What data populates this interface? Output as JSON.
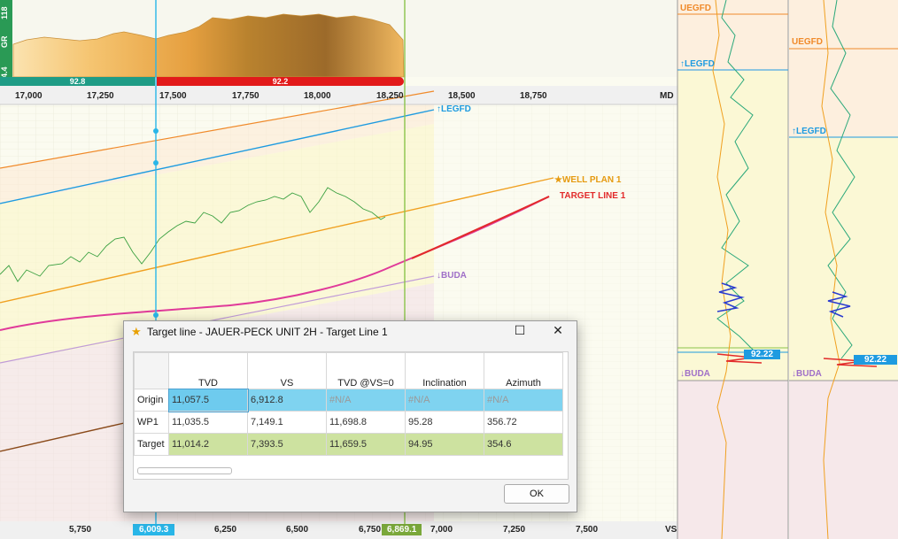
{
  "gamma_track": {
    "label": "GR",
    "scale_max": "118",
    "scale_min": "4.4",
    "bar_left_value": "92.8",
    "bar_right_value": "92.2",
    "colors": {
      "left_bar": "#1f9c86",
      "right_bar": "#e21a1a"
    }
  },
  "md_axis": {
    "ticks": [
      "17,000",
      "17,250",
      "17,500",
      "17,750",
      "18,000",
      "18,250",
      "18,500",
      "18,750"
    ],
    "unit": "MD"
  },
  "vs_axis": {
    "ticks": [
      "5,750",
      "6,250",
      "6,500",
      "6,750",
      "7,000",
      "7,250",
      "7,500"
    ],
    "unit": "VS",
    "cursor_a": "6,009.3",
    "cursor_b": "6,869.1",
    "colors": {
      "cursor_a": "#29b6e8",
      "cursor_b": "#7aa83a"
    }
  },
  "section_labels": {
    "legfd": "↑LEGFD",
    "well_plan": "★WELL PLAN 1",
    "target_line": "TARGET LINE 1",
    "buda": "↓BUDA"
  },
  "log_panel_1": {
    "uegfd": "UEGFD",
    "legfd": "↑LEGFD",
    "buda": "↓BUDA",
    "value": "92.22"
  },
  "log_panel_2": {
    "uegfd": "UEGFD",
    "legfd": "↑LEGFD",
    "buda": "↓BUDA",
    "value": "92.22"
  },
  "dialog": {
    "title": "Target line - JAUER-PECK UNIT 2H - Target Line 1",
    "columns": [
      "TVD",
      "VS",
      "TVD @VS=0",
      "Inclination",
      "Azimuth"
    ],
    "rows": [
      {
        "label": "Origin",
        "values": [
          "11,057.5",
          "6,912.8",
          "#N/A",
          "#N/A",
          "#N/A"
        ]
      },
      {
        "label": "WP1",
        "values": [
          "11,035.5",
          "7,149.1",
          "11,698.8",
          "95.28",
          "356.72"
        ]
      },
      {
        "label": "Target",
        "values": [
          "11,014.2",
          "7,393.5",
          "11,659.5",
          "94.95",
          "354.6"
        ]
      }
    ],
    "ok_label": "OK",
    "colors": {
      "origin_row": "#7fd3f0",
      "target_row": "#cde2a0"
    }
  }
}
